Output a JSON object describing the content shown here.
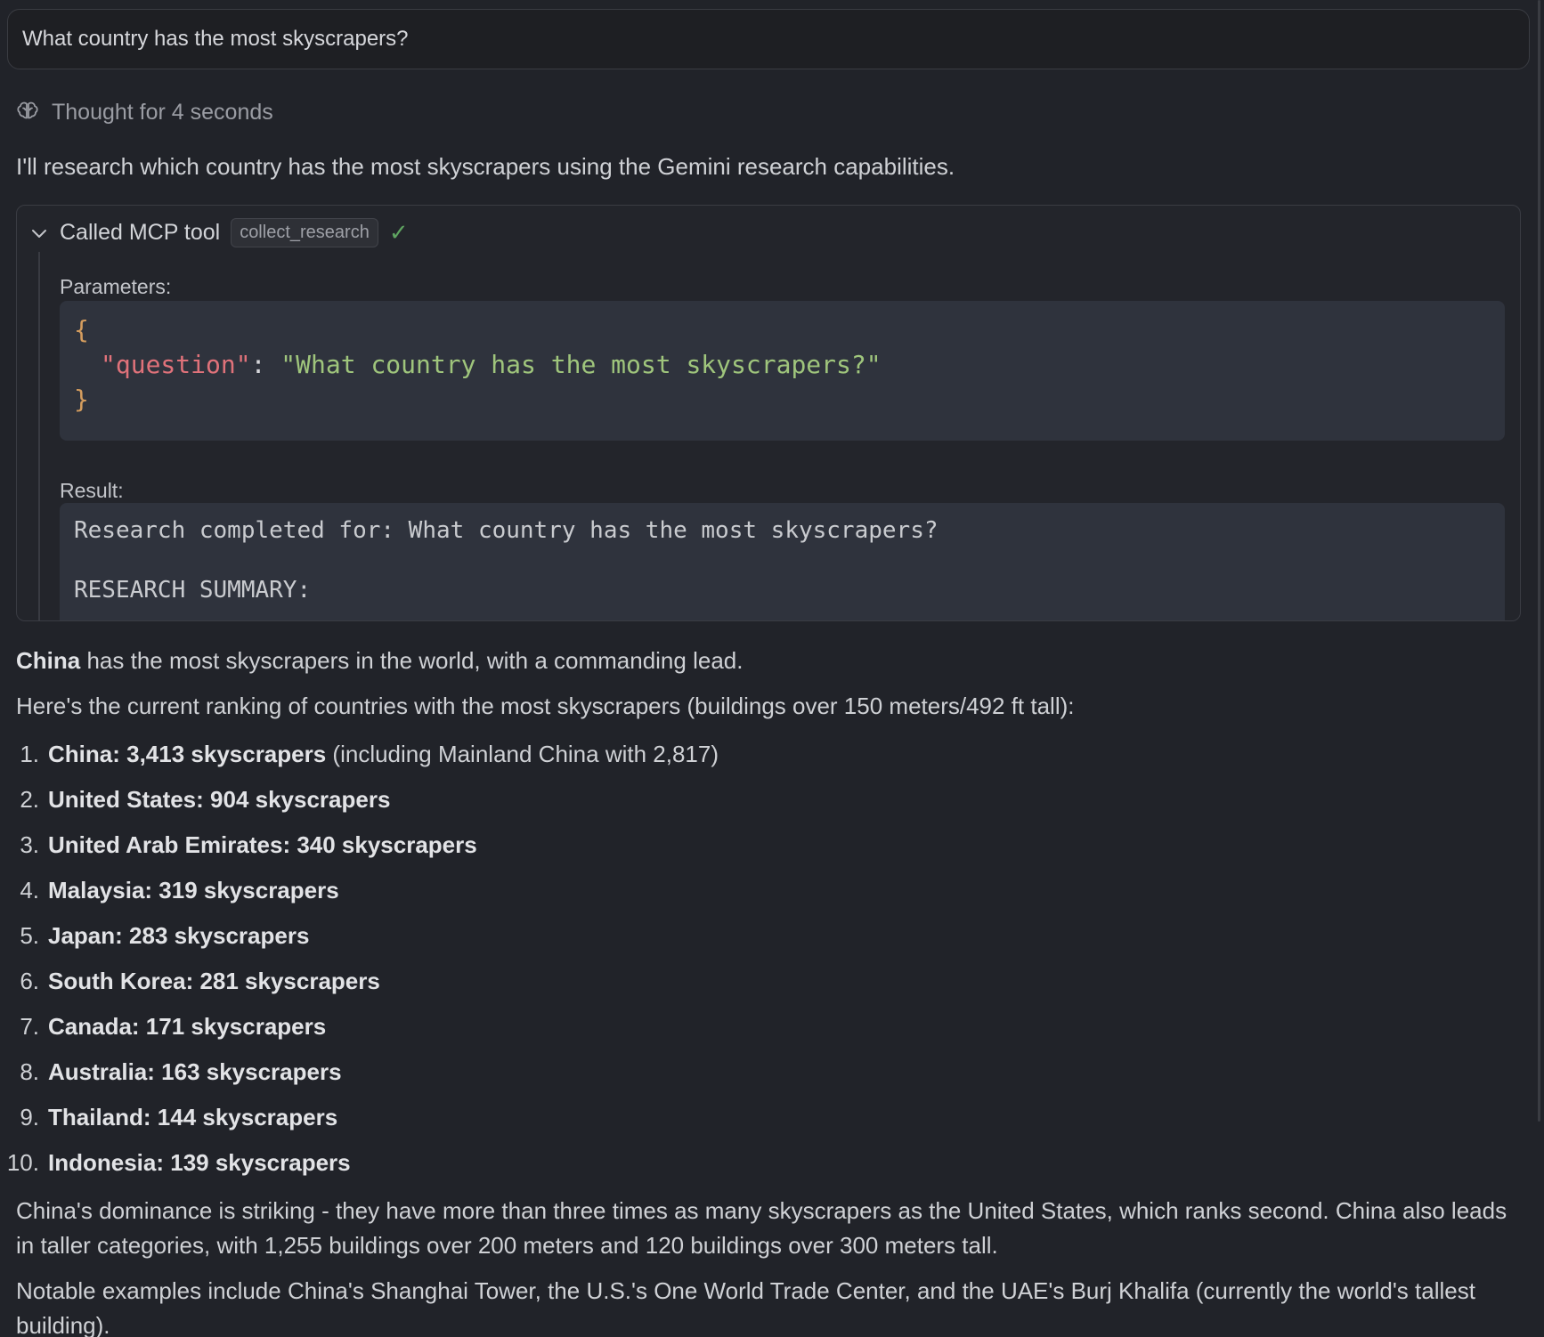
{
  "query": {
    "text": "What country has the most skyscrapers?"
  },
  "thought": {
    "label": "Thought for 4 seconds",
    "icon": "brain-icon"
  },
  "intro_text": "I'll research which country has the most skyscrapers using the Gemini research capabilities.",
  "tool_call": {
    "header": "Called MCP tool",
    "tool_name": "collect_research",
    "status_icon": "check-icon",
    "parameters_label": "Parameters:",
    "params": {
      "open_brace": "{",
      "key": "\"question\"",
      "colon": ": ",
      "value": "\"What country has the most skyscrapers?\"",
      "close_brace": "}"
    },
    "result_label": "Result:",
    "result_lines": [
      "Research completed for: What country has the most skyscrapers?",
      "RESEARCH SUMMARY:"
    ]
  },
  "answer": {
    "lead_bold": "China",
    "lead_rest": " has the most skyscrapers in the world, with a commanding lead.",
    "ranking_intro": "Here's the current ranking of countries with the most skyscrapers (buildings over 150 meters/492 ft tall):",
    "ranking": [
      {
        "num": "1.",
        "bold": "China: 3,413 skyscrapers",
        "rest": " (including Mainland China with 2,817)"
      },
      {
        "num": "2.",
        "bold": "United States: 904 skyscrapers",
        "rest": ""
      },
      {
        "num": "3.",
        "bold": "United Arab Emirates: 340 skyscrapers",
        "rest": ""
      },
      {
        "num": "4.",
        "bold": "Malaysia: 319 skyscrapers",
        "rest": ""
      },
      {
        "num": "5.",
        "bold": "Japan: 283 skyscrapers",
        "rest": ""
      },
      {
        "num": "6.",
        "bold": "South Korea: 281 skyscrapers",
        "rest": ""
      },
      {
        "num": "7.",
        "bold": "Canada: 171 skyscrapers",
        "rest": ""
      },
      {
        "num": "8.",
        "bold": "Australia: 163 skyscrapers",
        "rest": ""
      },
      {
        "num": "9.",
        "bold": "Thailand: 144 skyscrapers",
        "rest": ""
      },
      {
        "num": "10.",
        "bold": "Indonesia: 139 skyscrapers",
        "rest": ""
      }
    ],
    "paragraph_1": "China's dominance is striking - they have more than three times as many skyscrapers as the United States, which ranks second. China also leads in taller categories, with 1,255 buildings over 200 meters and 120 buildings over 300 meters tall.",
    "paragraph_2": "Notable examples include China's Shanghai Tower, the U.S.'s One World Trade Center, and the UAE's Burj Khalifa (currently the world's tallest building)."
  }
}
